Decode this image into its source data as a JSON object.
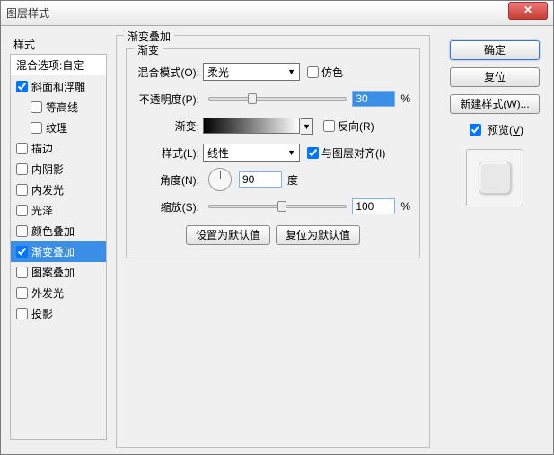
{
  "window": {
    "title": "图层样式"
  },
  "left": {
    "heading": "样式",
    "sub": "混合选项:自定",
    "items": [
      {
        "label": "斜面和浮雕",
        "checked": true
      },
      {
        "label": "等高线",
        "checked": false,
        "sub": true
      },
      {
        "label": "纹理",
        "checked": false,
        "sub": true
      },
      {
        "label": "描边",
        "checked": false
      },
      {
        "label": "内阴影",
        "checked": false
      },
      {
        "label": "内发光",
        "checked": false
      },
      {
        "label": "光泽",
        "checked": false
      },
      {
        "label": "颜色叠加",
        "checked": false
      },
      {
        "label": "渐变叠加",
        "checked": true,
        "selected": true
      },
      {
        "label": "图案叠加",
        "checked": false
      },
      {
        "label": "外发光",
        "checked": false
      },
      {
        "label": "投影",
        "checked": false
      }
    ]
  },
  "main": {
    "title": "渐变叠加",
    "group": "渐变",
    "blend_label": "混合模式(O):",
    "blend_value": "柔光",
    "dither_label": "仿色",
    "opacity_label": "不透明度(P):",
    "opacity_value": "30",
    "percent": "%",
    "gradient_label": "渐变:",
    "reverse_label": "反向(R)",
    "style_label": "样式(L):",
    "style_value": "线性",
    "align_label": "与图层对齐(I)",
    "angle_label": "角度(N):",
    "angle_value": "90",
    "angle_unit": "度",
    "scale_label": "缩放(S):",
    "scale_value": "100",
    "btn_default": "设置为默认值",
    "btn_reset": "复位为默认值"
  },
  "right": {
    "ok": "确定",
    "cancel": "复位",
    "newstyle": "新建样式(W)...",
    "preview_label": "预览(V)"
  }
}
